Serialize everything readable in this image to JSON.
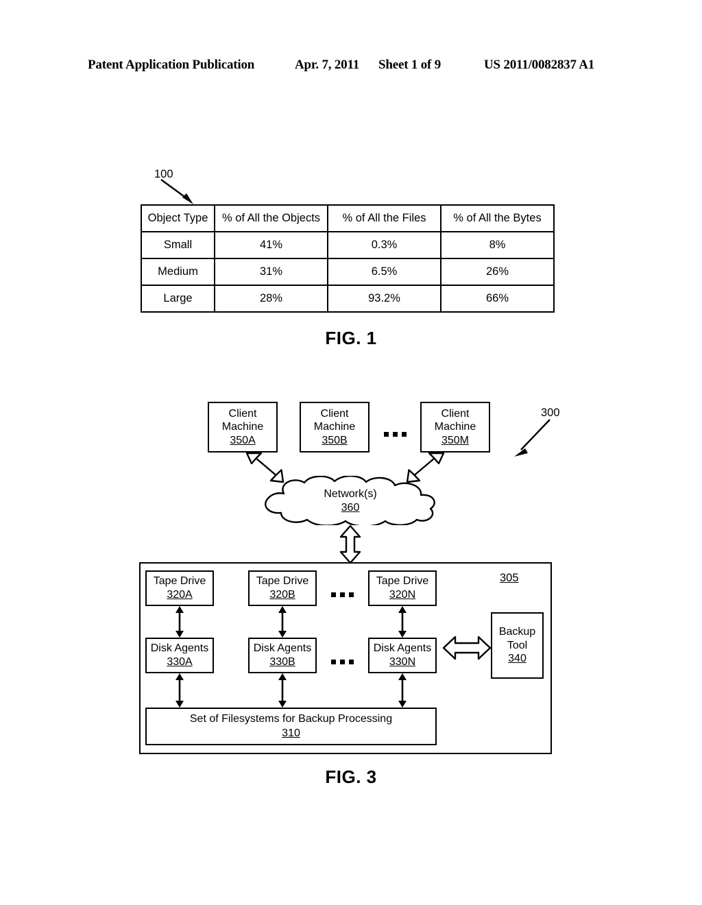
{
  "header": {
    "publication": "Patent Application Publication",
    "date": "Apr. 7, 2011",
    "sheet": "Sheet 1 of 9",
    "number": "US 2011/0082837 A1"
  },
  "fig1": {
    "caption": "FIG. 1",
    "reference": "100",
    "table": {
      "columns": [
        "Object Type",
        "% of All the Objects",
        "% of All the Files",
        "% of All the Bytes"
      ],
      "rows": [
        [
          "Small",
          "41%",
          "0.3%",
          "8%"
        ],
        [
          "Medium",
          "31%",
          "6.5%",
          "26%"
        ],
        [
          "Large",
          "28%",
          "93.2%",
          "66%"
        ]
      ]
    }
  },
  "fig3": {
    "caption": "FIG. 3",
    "reference": "300",
    "system_reference": "305",
    "ellipsis": "...",
    "clients": [
      {
        "line1": "Client",
        "line2": "Machine",
        "ref": "350A"
      },
      {
        "line1": "Client",
        "line2": "Machine",
        "ref": "350B"
      },
      {
        "line1": "Client",
        "line2": "Machine",
        "ref": "350M"
      }
    ],
    "network": {
      "label": "Network(s)",
      "ref": "360"
    },
    "tape_drives": [
      {
        "label": "Tape Drive",
        "ref": "320A"
      },
      {
        "label": "Tape Drive",
        "ref": "320B"
      },
      {
        "label": "Tape Drive",
        "ref": "320N"
      }
    ],
    "disk_agents": [
      {
        "label": "Disk Agents",
        "ref": "330A"
      },
      {
        "label": "Disk Agents",
        "ref": "330B"
      },
      {
        "label": "Disk Agents",
        "ref": "330N"
      }
    ],
    "backup_tool": {
      "line1": "Backup",
      "line2": "Tool",
      "ref": "340"
    },
    "filesystems": {
      "label": "Set of Filesystems for Backup Processing",
      "ref": "310"
    }
  },
  "colors": {
    "ink": "#000000",
    "paper": "#ffffff"
  }
}
